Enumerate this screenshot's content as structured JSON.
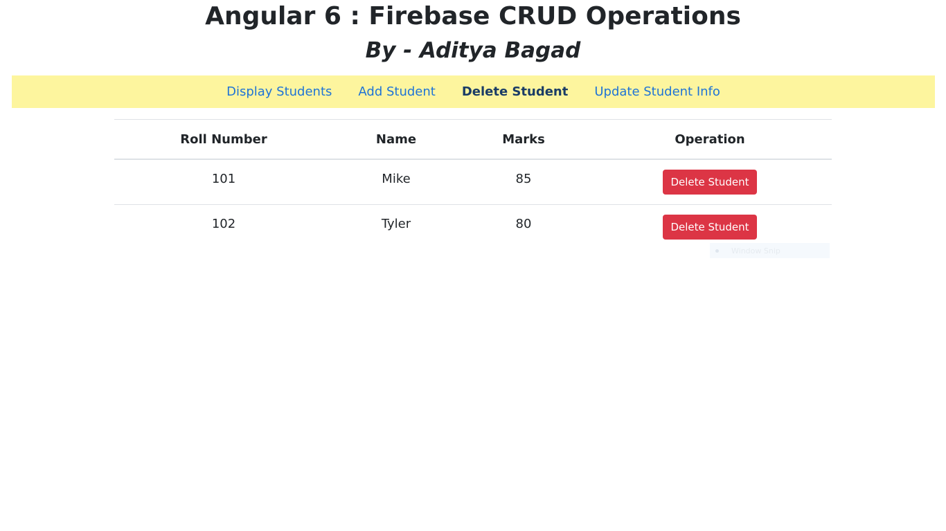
{
  "header": {
    "title": "Angular 6 : Firebase CRUD Operations",
    "subtitle": "By - Aditya Bagad"
  },
  "nav": {
    "items": [
      {
        "label": "Display Students"
      },
      {
        "label": "Add Student"
      },
      {
        "label": "Delete Student",
        "active": true
      },
      {
        "label": "Update Student Info"
      }
    ]
  },
  "table": {
    "headers": [
      "Roll Number",
      "Name",
      "Marks",
      "Operation"
    ],
    "rows": [
      {
        "roll": "101",
        "name": "Mike",
        "marks": "85",
        "action": "Delete Student"
      },
      {
        "roll": "102",
        "name": "Tyler",
        "marks": "80",
        "action": "Delete Student"
      }
    ]
  },
  "tooltip": {
    "text": "Window Snip"
  },
  "colors": {
    "navbar_bg": "#fdf59e",
    "link": "#1e73d6",
    "link_active": "#1a3c66",
    "danger": "#dc3545"
  }
}
